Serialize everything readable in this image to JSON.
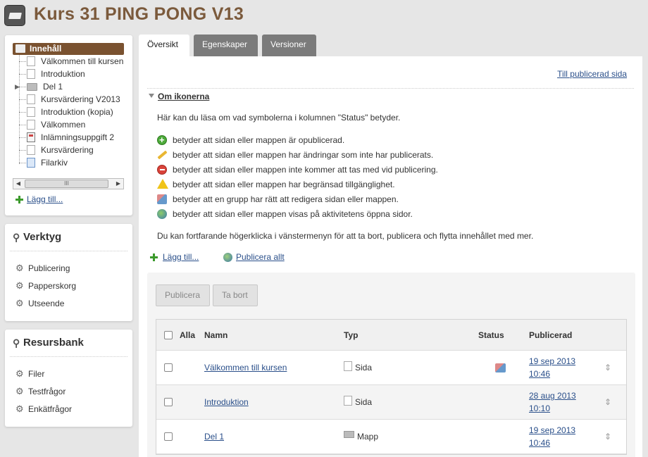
{
  "header": {
    "title": "Kurs 31 PING PONG V13"
  },
  "tree": {
    "root": "Innehåll",
    "items": [
      {
        "label": "Välkommen till kursen",
        "icon": "page-icon"
      },
      {
        "label": "Introduktion",
        "icon": "page-icon"
      },
      {
        "label": "Del 1",
        "icon": "folder-icon"
      },
      {
        "label": "Kursvärdering V2013",
        "icon": "survey-icon"
      },
      {
        "label": "Introduktion (kopia)",
        "icon": "page-icon"
      },
      {
        "label": "Välkommen",
        "icon": "page-icon"
      },
      {
        "label": "Inlämningsuppgift 2",
        "icon": "assignment-icon"
      },
      {
        "label": "Kursvärdering",
        "icon": "survey-icon"
      },
      {
        "label": "Filarkiv",
        "icon": "file-archive-icon"
      }
    ],
    "scroll_thumb": "III",
    "add_label": "Lägg till..."
  },
  "verktyg": {
    "title": "Verktyg",
    "items": [
      "Publicering",
      "Papperskorg",
      "Utseende"
    ]
  },
  "resursbank": {
    "title": "Resursbank",
    "items": [
      "Filer",
      "Testfrågor",
      "Enkätfrågor"
    ]
  },
  "tabs": [
    "Översikt",
    "Egenskaper",
    "Versioner"
  ],
  "main": {
    "to_published": "Till publicerad sida",
    "om_title": "Om ikonerna",
    "om_desc": "Här kan du läsa om vad symbolerna i kolumnen \"Status\" betyder.",
    "legend": [
      {
        "icon": "unpublished-icon",
        "text": "betyder att sidan eller mappen är opublicerad."
      },
      {
        "icon": "edited-icon",
        "text": "betyder att sidan eller mappen har ändringar som inte har publicerats."
      },
      {
        "icon": "excluded-icon",
        "text": "betyder att sidan eller mappen inte kommer att tas med vid publicering."
      },
      {
        "icon": "restricted-icon",
        "text": "betyder att sidan eller mappen har begränsad tillgänglighet."
      },
      {
        "icon": "group-icon",
        "text": "betyder att en grupp har rätt att redigera sidan eller mappen."
      },
      {
        "icon": "public-icon",
        "text": "betyder att sidan eller mappen visas på aktivitetens öppna sidor."
      }
    ],
    "om_footer": "Du kan fortfarande högerklicka i vänstermenyn för att ta bort, publicera och flytta innehållet med mer.",
    "add_label": "Lägg till...",
    "publish_all_label": "Publicera allt",
    "btn_publicera": "Publicera",
    "btn_tabort": "Ta bort",
    "columns": {
      "alla": "Alla",
      "namn": "Namn",
      "typ": "Typ",
      "status": "Status",
      "publicerad": "Publicerad"
    },
    "rows": [
      {
        "name": "Välkommen till kursen",
        "typ": "Sida",
        "status_icon": "group-icon",
        "date": "19 sep 2013",
        "time": "10:46"
      },
      {
        "name": "Introduktion",
        "typ": "Sida",
        "status_icon": "",
        "date": "28 aug 2013",
        "time": "10:10"
      },
      {
        "name": "Del 1",
        "typ": "Mapp",
        "status_icon": "",
        "date": "19 sep 2013",
        "time": "10:46"
      }
    ]
  }
}
